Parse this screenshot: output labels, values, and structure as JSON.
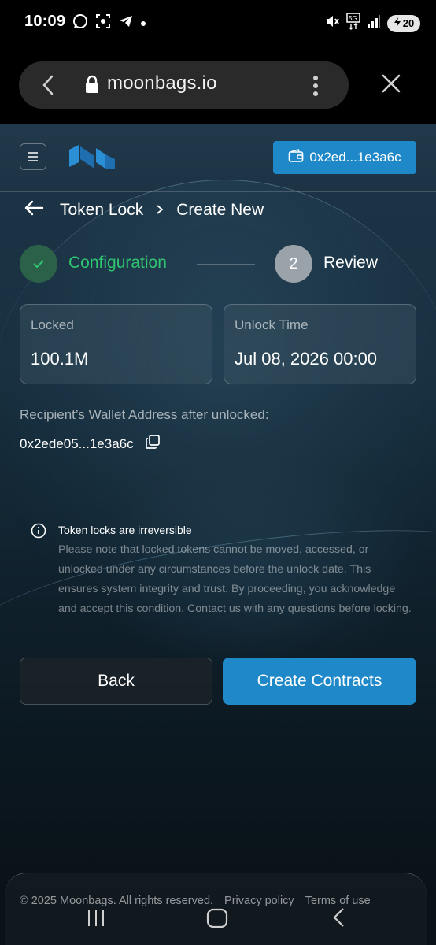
{
  "status_bar": {
    "time": "10:09",
    "battery": "20"
  },
  "browser": {
    "url": "moonbags.io"
  },
  "header": {
    "wallet_address": "0x2ed...1e3a6c"
  },
  "breadcrumb": {
    "parent": "Token Lock",
    "current": "Create New"
  },
  "stepper": {
    "step1_label": "Configuration",
    "step2_number": "2",
    "step2_label": "Review"
  },
  "summary": {
    "locked_label": "Locked",
    "locked_value": "100.1M",
    "unlock_label": "Unlock Time",
    "unlock_value": "Jul 08, 2026 00:00"
  },
  "recipient": {
    "label": "Recipient’s Wallet Address after unlocked:",
    "address": "0x2ede05...1e3a6c"
  },
  "notice": {
    "title": "Token locks are irreversible",
    "body": "Please note that locked tokens cannot be moved, accessed, or unlocked under any circumstances before the unlock date. This ensures system integrity and trust. By proceeding, you acknowledge and accept this condition. Contact us with any questions before locking."
  },
  "actions": {
    "back_label": "Back",
    "create_label": "Create Contracts"
  },
  "footer": {
    "copyright": "© 2025 Moonbags. All rights reserved.",
    "privacy": "Privacy policy",
    "terms": "Terms of use"
  },
  "colors": {
    "accent": "#1e88c9",
    "success": "#31c670"
  }
}
